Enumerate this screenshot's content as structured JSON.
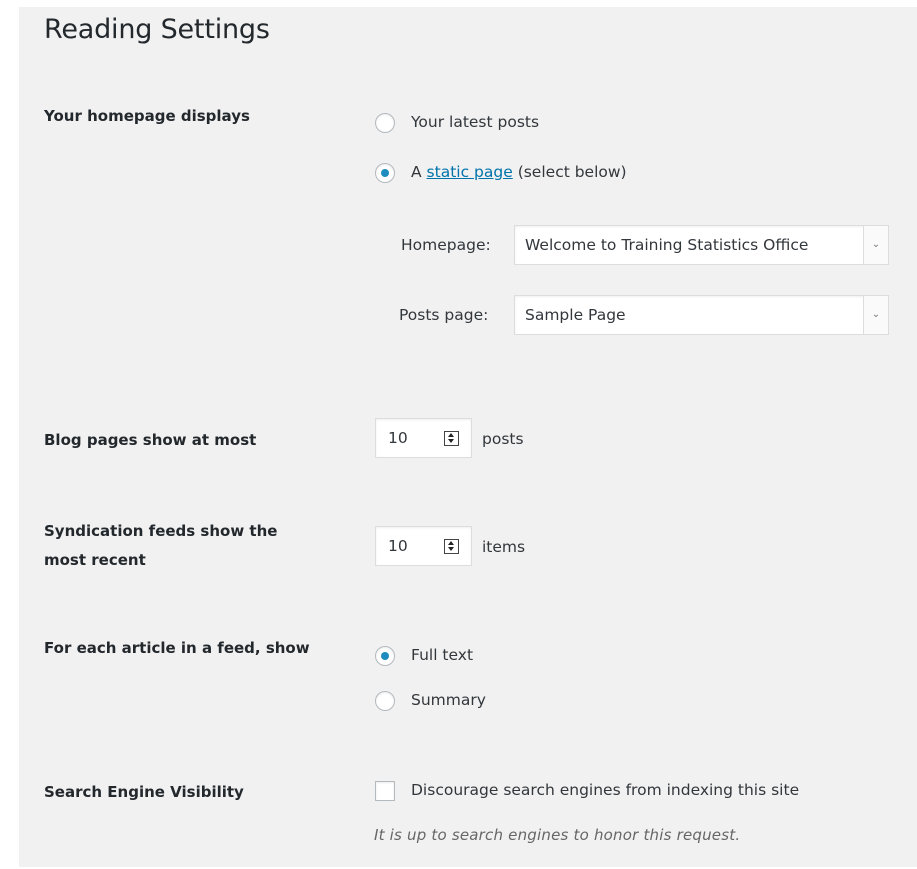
{
  "page": {
    "title": "Reading Settings"
  },
  "homepage_displays": {
    "label": "Your homepage displays",
    "options": [
      {
        "label": "Your latest posts",
        "checked": false
      },
      {
        "prefix": "A",
        "link_text": "static page",
        "suffix": "(select below)",
        "checked": true
      }
    ],
    "homepage_select": {
      "label": "Homepage:",
      "value": "Welcome to Training Statistics Office"
    },
    "posts_page_select": {
      "label": "Posts page:",
      "value": "Sample Page"
    }
  },
  "blog_pages": {
    "label": "Blog pages show at most",
    "value": "10",
    "unit": "posts"
  },
  "syndication": {
    "label_line1": "Syndication feeds show the",
    "label_line2": "most recent",
    "value": "10",
    "unit": "items"
  },
  "feed_article": {
    "label": "For each article in a feed, show",
    "options": [
      {
        "label": "Full text",
        "checked": true
      },
      {
        "label": "Summary",
        "checked": false
      }
    ]
  },
  "search_visibility": {
    "label": "Search Engine Visibility",
    "checkbox_label": "Discourage search engines from indexing this site",
    "checked": false,
    "description": "It is up to search engines to honor this request."
  },
  "colors": {
    "background": "#f1f1f1",
    "accent": "#1e8cbe",
    "link": "#0073aa"
  }
}
